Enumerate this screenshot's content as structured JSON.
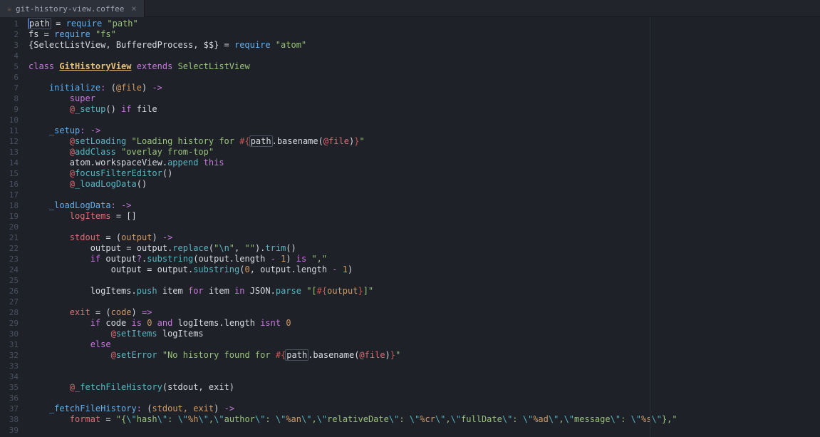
{
  "tab": {
    "icon": "☕",
    "filename": "git-history-view.coffee",
    "close": "×"
  },
  "gutter_start": 1,
  "gutter_end": 39,
  "code": {
    "l1": {
      "a": "path",
      "b": " = ",
      "c": "require",
      "d": " ",
      "e": "\"path\""
    },
    "l2": {
      "a": "fs = ",
      "b": "require",
      "c": " ",
      "d": "\"fs\""
    },
    "l3": {
      "a": "{SelectListView, BufferedProcess, $$} = ",
      "b": "require",
      "c": " ",
      "d": "\"atom\""
    },
    "l5": {
      "a": "class",
      "b": " ",
      "c": "GitHistoryView",
      "d": " ",
      "e": "extends",
      "f": " ",
      "g": "SelectListView"
    },
    "l7": {
      "a": "    ",
      "b": "initialize",
      "c": ":",
      "d": " ",
      "e": "(",
      "f": "@file",
      "g": ")",
      "h": " ",
      "i": "->"
    },
    "l8": {
      "a": "        ",
      "b": "super"
    },
    "l9": {
      "a": "        ",
      "b": "@",
      "c": "_setup",
      "d": "() ",
      "e": "if",
      "f": " file"
    },
    "l11": {
      "a": "    ",
      "b": "_setup",
      "c": ":",
      "d": " ",
      "e": "->"
    },
    "l12": {
      "a": "        ",
      "b": "@",
      "c": "setLoading",
      "d": " ",
      "e": "\"Loading history for ",
      "f": "#{",
      "g": "path",
      "h": ".basename(",
      "i": "@file",
      "j": ")",
      "k": "}",
      "l": "\""
    },
    "l13": {
      "a": "        ",
      "b": "@",
      "c": "addClass",
      "d": " ",
      "e": "\"overlay from-top\""
    },
    "l14": {
      "a": "        atom.workspaceView.",
      "b": "append",
      "c": " ",
      "d": "this"
    },
    "l15": {
      "a": "        ",
      "b": "@",
      "c": "focusFilterEditor",
      "d": "()"
    },
    "l16": {
      "a": "        ",
      "b": "@",
      "c": "_loadLogData",
      "d": "()"
    },
    "l18": {
      "a": "    ",
      "b": "_loadLogData",
      "c": ":",
      "d": " ",
      "e": "->"
    },
    "l19": {
      "a": "        ",
      "b": "logItems",
      "c": " = []"
    },
    "l21": {
      "a": "        ",
      "b": "stdout",
      "c": " = ",
      "d": "(",
      "e": "output",
      "f": ")",
      "g": " ",
      "h": "->"
    },
    "l22": {
      "a": "            output = output.",
      "b": "replace",
      "c": "(",
      "d": "\"",
      "e": "\\n",
      "f": "\"",
      "g": ", ",
      "h": "\"\"",
      "i": ").",
      "j": "trim",
      "k": "()"
    },
    "l23": {
      "a": "            ",
      "b": "if",
      "c": " output",
      "d": "?",
      "e": ".",
      "f": "substring",
      "g": "(output.length ",
      "h": "-",
      "i": " ",
      "j": "1",
      "k": ") ",
      "l": "is",
      "m": " ",
      "n": "\",\""
    },
    "l24": {
      "a": "                output = output.",
      "b": "substring",
      "c": "(",
      "d": "0",
      "e": ", output.length ",
      "f": "-",
      "g": " ",
      "h": "1",
      "i": ")"
    },
    "l26": {
      "a": "            logItems.",
      "b": "push",
      "c": " item ",
      "d": "for",
      "e": " item ",
      "f": "in",
      "g": " JSON.",
      "h": "parse",
      "i": " ",
      "j": "\"[",
      "k": "#{",
      "l": "output",
      "m": "}",
      "n": "]\""
    },
    "l28": {
      "a": "        ",
      "b": "exit",
      "c": " = ",
      "d": "(",
      "e": "code",
      "f": ")",
      "g": " ",
      "h": "=>"
    },
    "l29": {
      "a": "            ",
      "b": "if",
      "c": " code ",
      "d": "is",
      "e": " ",
      "f": "0",
      "g": " ",
      "h": "and",
      "i": " logItems.length ",
      "j": "isnt",
      "k": " ",
      "l": "0"
    },
    "l30": {
      "a": "                ",
      "b": "@",
      "c": "setItems",
      "d": " logItems"
    },
    "l31": {
      "a": "            ",
      "b": "else"
    },
    "l32": {
      "a": "                ",
      "b": "@",
      "c": "setError",
      "d": " ",
      "e": "\"No history found for ",
      "f": "#{",
      "g": "path",
      "h": ".basename(",
      "i": "@file",
      "j": ")",
      "k": "}",
      "l": "\""
    },
    "l35": {
      "a": "        ",
      "b": "@",
      "c": "_fetchFileHistory",
      "d": "(stdout, exit)"
    },
    "l37": {
      "a": "    ",
      "b": "_fetchFileHistory",
      "c": ":",
      "d": " ",
      "e": "(",
      "f": "stdout, exit",
      "g": ")",
      "h": " ",
      "i": "->"
    },
    "l38": {
      "a": "        ",
      "b": "format",
      "c": " = ",
      "d": "\"{",
      "e": "\\\"",
      "f": "hash",
      "g": "\\\"",
      "h": ": ",
      "i": "\\\"",
      "j": "%h",
      "k": "\\\"",
      "l": ",",
      "m": "\\\"",
      "n": "author",
      "o": "\\\"",
      "p": ": ",
      "q": "\\\"",
      "r": "%an",
      "s": "\\\"",
      "t": ",",
      "u": "\\\"",
      "v": "relativeDate",
      "w": "\\\"",
      "x": ": ",
      "y": "\\\"",
      "z": "%cr",
      "aa": "\\\"",
      "ab": ",",
      "ac": "\\\"",
      "ad": "fullDate",
      "ae": "\\\"",
      "af": ": ",
      "ag": "\\\"",
      "ah": "%ad",
      "ai": "\\\"",
      "aj": ",",
      "ak": "\\\"",
      "al": "message",
      "am": "\\\"",
      "an": ": ",
      "ao": "\\\"",
      "ap": "%s",
      "aq": "\\\"",
      "ar": "},\""
    }
  }
}
